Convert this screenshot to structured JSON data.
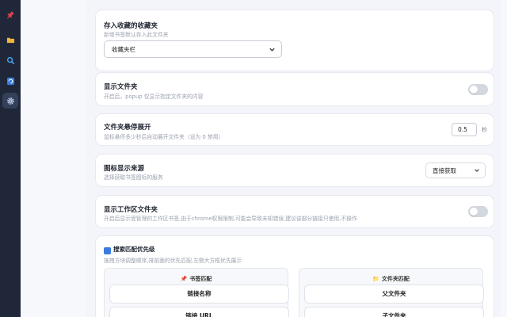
{
  "rail": {
    "items": [
      {
        "icon": "pin-icon"
      },
      {
        "icon": "folder-icon"
      },
      {
        "icon": "search-icon"
      },
      {
        "icon": "refresh-icon"
      },
      {
        "icon": "gear-icon",
        "active": true
      }
    ]
  },
  "save_folder": {
    "title": "存入收藏的收藏夹",
    "desc": "新增书签默认存入此文件夹",
    "selected": "收藏夹栏"
  },
  "show_folder": {
    "title": "显示文件夹",
    "desc": "开启后，popup 仅显示指定文件夹的内容",
    "enabled": false
  },
  "hover_expand": {
    "title": "文件夹悬停展开",
    "desc": "鼠标悬停多少秒后自动展开文件夹（设为 0 禁用）",
    "value": "0.5",
    "unit": "秒"
  },
  "icon_source": {
    "title": "图标显示来源",
    "desc": "选择获取书签图标的服务",
    "selected": "直接获取"
  },
  "workspace_folder": {
    "title": "显示工作区文件夹",
    "desc": "开启后显示受管理的工作区书签,由于chrome权限限制,可能会导致未知错误,建议该部分链接只使用,不操作",
    "enabled": false
  },
  "search_priority": {
    "title": "搜索匹配优先级",
    "desc": "拖拽方块调整顺序,排前面的优先匹配,左侧大方框优先展示",
    "bookmark_panel": {
      "title": "书签匹配",
      "icon": "pin-icon",
      "items": [
        "链接名称",
        "链接 URL"
      ]
    },
    "folder_panel": {
      "title": "文件夹匹配",
      "icon": "folder-icon",
      "items": [
        "父文件夹",
        "子文件夹"
      ]
    }
  },
  "colors": {
    "sidebar": "#1f2739",
    "accent": "#3a7be0",
    "pin": "#e2404b",
    "folder": "#f2b53c"
  }
}
